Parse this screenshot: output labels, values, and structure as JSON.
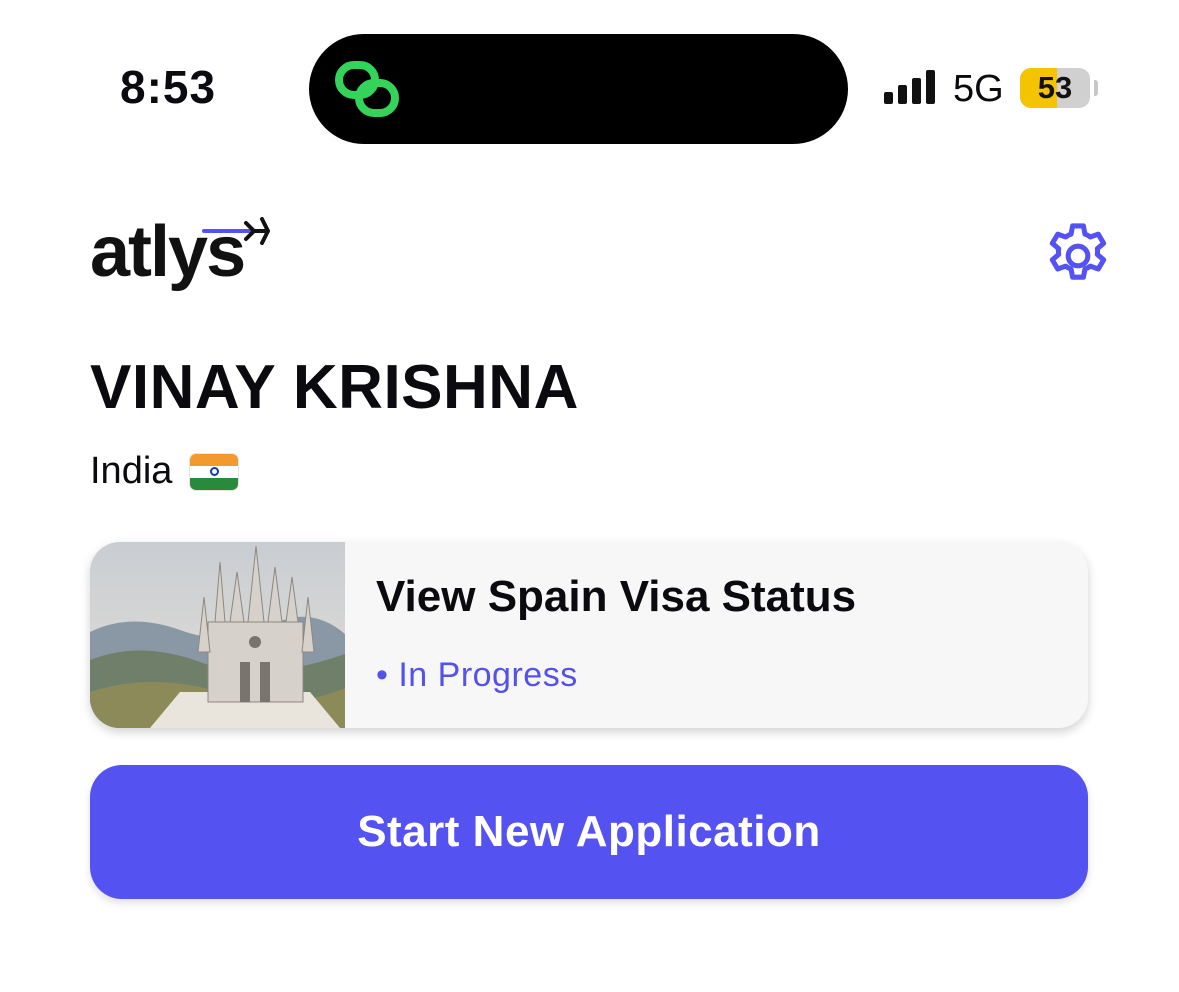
{
  "status_bar": {
    "time": "8:53",
    "network": "5G",
    "battery": "53",
    "battery_level": 0.53,
    "signal_bars": 4
  },
  "header": {
    "logo_text": "atlys",
    "settings_icon": "gear-icon"
  },
  "profile": {
    "name": "VINAY KRISHNA",
    "country": "India",
    "flag_icon": "india-flag-icon"
  },
  "visa_card": {
    "title": "View Spain Visa Status",
    "status": "• In Progress",
    "image": "sagrat-cor-church-photo"
  },
  "actions": {
    "start_label": "Start New Application"
  },
  "colors": {
    "accent": "#5552f2",
    "status_text": "#5452e8",
    "island_icon": "#34d35a",
    "battery_fill": "#f5c400"
  }
}
